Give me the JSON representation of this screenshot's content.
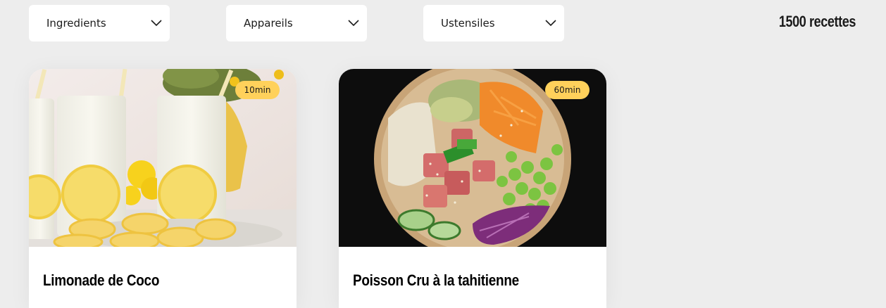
{
  "filters": [
    {
      "label": "Ingredients",
      "icon": "chevron-down-icon"
    },
    {
      "label": "Appareils",
      "icon": "chevron-down-icon"
    },
    {
      "label": "Ustensiles",
      "icon": "chevron-down-icon"
    }
  ],
  "recipe_count": "1500 recettes",
  "recipes": [
    {
      "title": "Limonade de Coco",
      "time": "10min",
      "image": "lemonade-glasses-photo"
    },
    {
      "title": "Poisson Cru à la tahitienne",
      "time": "60min",
      "image": "poke-bowl-photo"
    }
  ],
  "colors": {
    "background": "#ededed",
    "badge": "#ffd15b",
    "card": "#ffffff",
    "text": "#1b1b1b"
  }
}
